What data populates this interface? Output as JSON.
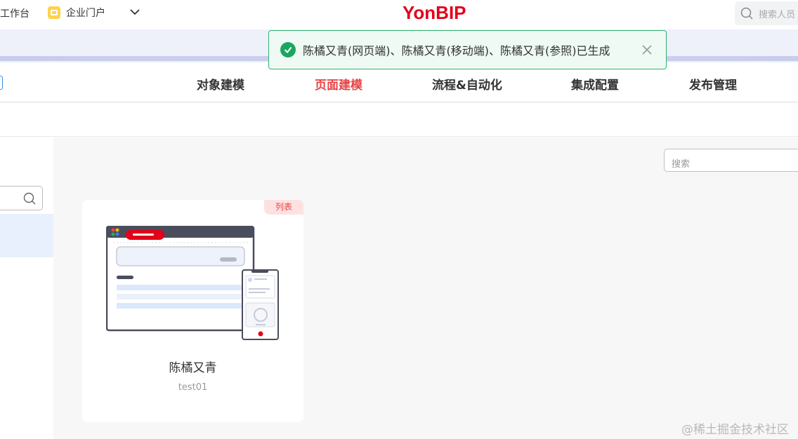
{
  "topbar": {
    "workbench_label": "工作台",
    "portal_label": "企业门户",
    "portal_icon": "portal-icon",
    "logo_text": "YonBIP",
    "search_placeholder": "搜索人员"
  },
  "nav": {
    "items": [
      {
        "label": "对象建模",
        "active": false
      },
      {
        "label": "页面建模",
        "active": true
      },
      {
        "label": "流程&自动化",
        "active": false
      },
      {
        "label": "集成配置",
        "active": false
      },
      {
        "label": "发布管理",
        "active": false
      }
    ]
  },
  "main": {
    "search_placeholder": "搜索",
    "cards": [
      {
        "tag": "列表",
        "title": "陈橘又青",
        "subtitle": "test01"
      }
    ]
  },
  "toast": {
    "message": "陈橘又青(网页端)、陈橘又青(移动端)、陈橘又青(参照)已生成",
    "type": "success"
  },
  "watermark": "@稀土掘金技术社区",
  "colors": {
    "accent_red": "#e64545",
    "brand_red": "#e3001b",
    "success_green": "#1aa65e",
    "selected_bg": "#e8f0fd"
  }
}
